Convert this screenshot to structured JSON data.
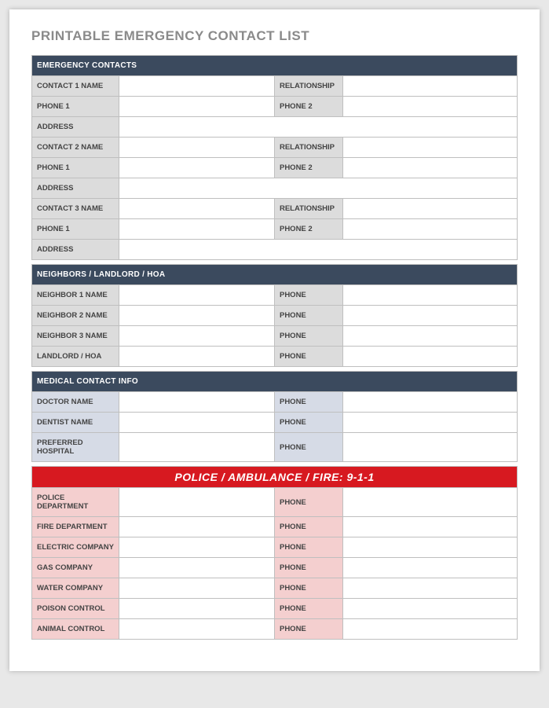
{
  "title": "PRINTABLE EMERGENCY CONTACT LIST",
  "sections": {
    "emergency": {
      "header": "EMERGENCY CONTACTS",
      "contacts": [
        {
          "name_label": "CONTACT 1 NAME",
          "rel_label": "RELATIONSHIP",
          "phone1_label": "PHONE 1",
          "phone2_label": "PHONE 2",
          "address_label": "ADDRESS"
        },
        {
          "name_label": "CONTACT 2 NAME",
          "rel_label": "RELATIONSHIP",
          "phone1_label": "PHONE 1",
          "phone2_label": "PHONE 2",
          "address_label": "ADDRESS"
        },
        {
          "name_label": "CONTACT 3 NAME",
          "rel_label": "RELATIONSHIP",
          "phone1_label": "PHONE 1",
          "phone2_label": "PHONE 2",
          "address_label": "ADDRESS"
        }
      ]
    },
    "neighbors": {
      "header": "NEIGHBORS / LANDLORD / HOA",
      "rows": [
        {
          "label": "NEIGHBOR 1 NAME",
          "plabel": "PHONE"
        },
        {
          "label": "NEIGHBOR 2 NAME",
          "plabel": "PHONE"
        },
        {
          "label": "NEIGHBOR 3 NAME",
          "plabel": "PHONE"
        },
        {
          "label": "LANDLORD / HOA",
          "plabel": "PHONE"
        }
      ]
    },
    "medical": {
      "header": "MEDICAL CONTACT INFO",
      "rows": [
        {
          "label": "DOCTOR NAME",
          "plabel": "PHONE"
        },
        {
          "label": "DENTIST NAME",
          "plabel": "PHONE"
        },
        {
          "label": "PREFERRED HOSPITAL",
          "plabel": "PHONE"
        }
      ]
    },
    "urgent": {
      "header": "POLICE / AMBULANCE / FIRE:  9-1-1",
      "rows": [
        {
          "label": "POLICE DEPARTMENT",
          "plabel": "PHONE"
        },
        {
          "label": "FIRE DEPARTMENT",
          "plabel": "PHONE"
        },
        {
          "label": "ELECTRIC COMPANY",
          "plabel": "PHONE"
        },
        {
          "label": "GAS COMPANY",
          "plabel": "PHONE"
        },
        {
          "label": "WATER COMPANY",
          "plabel": "PHONE"
        },
        {
          "label": "POISON CONTROL",
          "plabel": "PHONE"
        },
        {
          "label": "ANIMAL CONTROL",
          "plabel": "PHONE"
        }
      ]
    }
  }
}
